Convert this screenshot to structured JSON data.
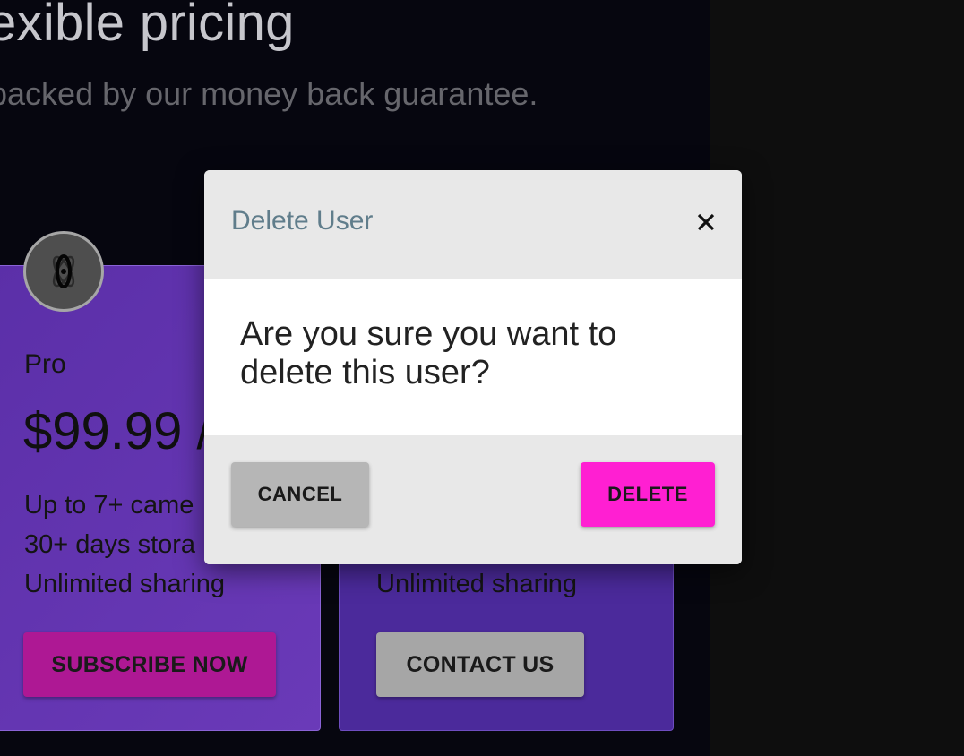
{
  "hero": {
    "title": "exible pricing",
    "subtitle": "backed by our money back guarantee."
  },
  "cards": {
    "pro": {
      "icon": "atom-icon",
      "name": "Pro",
      "price": "$99.99 /",
      "features": [
        "Up to 7+ came",
        "30+ days stora",
        "Unlimited sharing"
      ],
      "button_label": "SUBSCRIBE NOW"
    },
    "enterprise": {
      "features": [
        "Unlimited sharing"
      ],
      "button_label": "CONTACT US"
    }
  },
  "dialog": {
    "title": "Delete User",
    "close_icon": "close-icon",
    "message": "Are you sure you want to delete this user?",
    "cancel_label": "CANCEL",
    "delete_label": "DELETE"
  },
  "colors": {
    "accent_magenta": "#ff1fd2",
    "card_purple": "#5b2fa8",
    "dialog_title": "#607d8b"
  }
}
